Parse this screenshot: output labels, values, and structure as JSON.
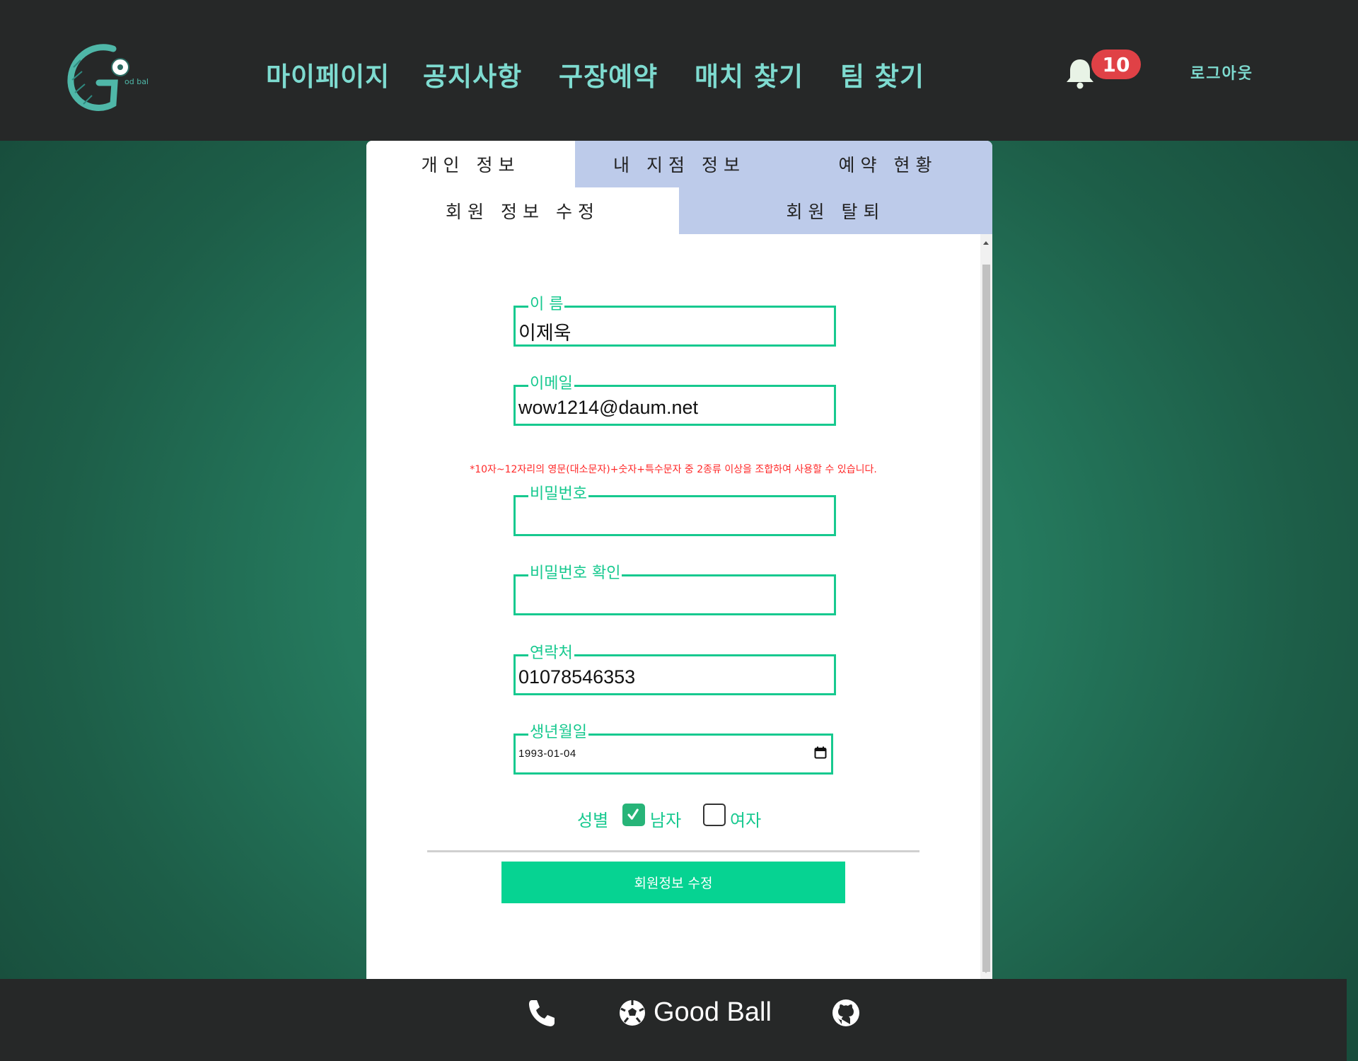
{
  "header": {
    "nav": [
      "마이페이지",
      "공지사항",
      "구장예약",
      "매치 찾기",
      "팀 찾기"
    ],
    "notification_count": "10",
    "logout_label": "로그아웃"
  },
  "tabs": {
    "primary": [
      "개인 정보",
      "내 지점 정보",
      "예약 현황"
    ],
    "primary_active": 0,
    "secondary": [
      "회원 정보 수정",
      "회원 탈퇴"
    ],
    "secondary_active": 0
  },
  "form": {
    "name_label": "이 름",
    "name_value": "이제욱",
    "email_label": "이메일",
    "email_value": "wow1214@daum.net",
    "password_notice": "*10자~12자리의 영문(대소문자)+숫자+특수문자 중 2종류 이상을 조합하여 사용할 수 있습니다.",
    "password_label": "비밀번호",
    "password_value": "",
    "password_confirm_label": "비밀번호 확인",
    "password_confirm_value": "",
    "phone_label": "연락처",
    "phone_value": "01078546353",
    "birth_label": "생년월일",
    "birth_value": "1993-01-04",
    "gender_label": "성별",
    "gender_options": [
      "남자",
      "여자"
    ],
    "gender_selected": "남자",
    "submit_label": "회원정보 수정"
  },
  "footer": {
    "brand": "Good Ball"
  },
  "colors": {
    "header_bg": "#262828",
    "nav_text": "#7edbd0",
    "badge": "#e04146",
    "tab_inactive": "#bdcbea",
    "field_border": "#17c98f",
    "submit_bg": "#06d392",
    "notice": "#ff2a2a"
  },
  "icons": [
    "logo-icon",
    "bell-icon",
    "calendar-icon",
    "check-icon",
    "phone-icon",
    "soccer-ball-icon",
    "github-icon"
  ]
}
